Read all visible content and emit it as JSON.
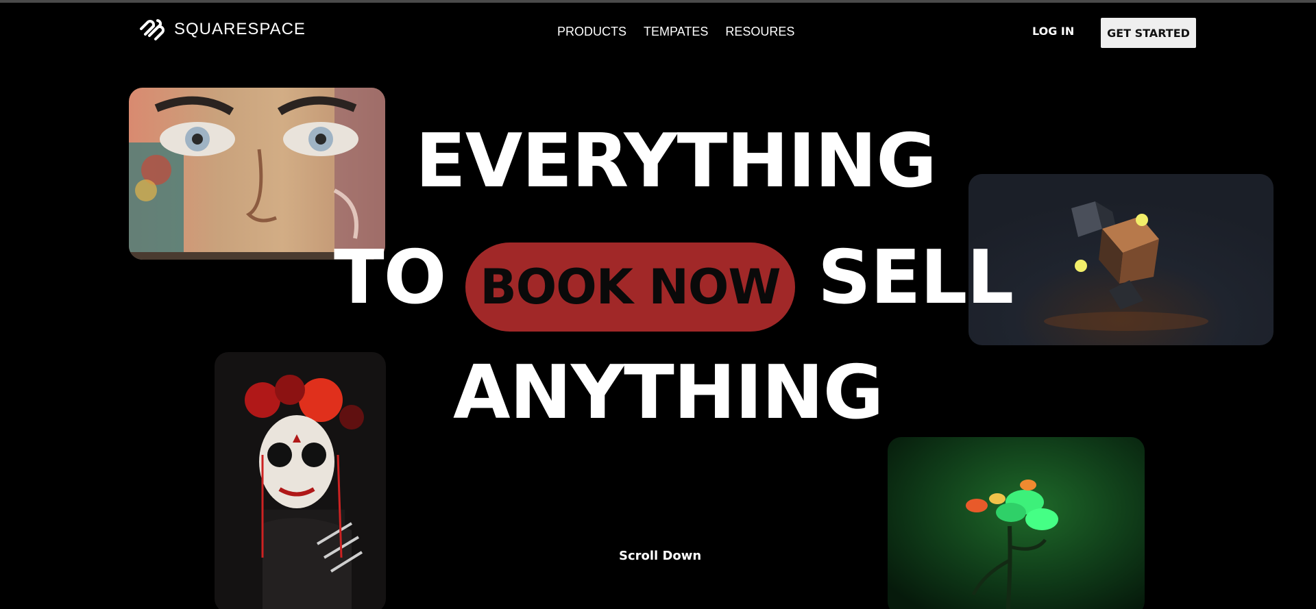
{
  "header": {
    "logo_text": "SQUARESPACE",
    "logo_icon": "squarespace-logo-icon",
    "nav": [
      {
        "label": "PRODUCTS"
      },
      {
        "label": "TEMPATES"
      },
      {
        "label": "RESOURES"
      }
    ],
    "login_label": "LOG IN",
    "cta_label": "GET STARTED"
  },
  "hero": {
    "line1": "EVERYTHING",
    "line2_left": "TO",
    "book_now": "BOOK NOW",
    "line2_right": "SELL",
    "line3": "ANYTHING",
    "scroll_label": "Scroll Down"
  },
  "colors": {
    "background": "#000000",
    "accent": "#a12828",
    "cta_background": "#efefef"
  }
}
